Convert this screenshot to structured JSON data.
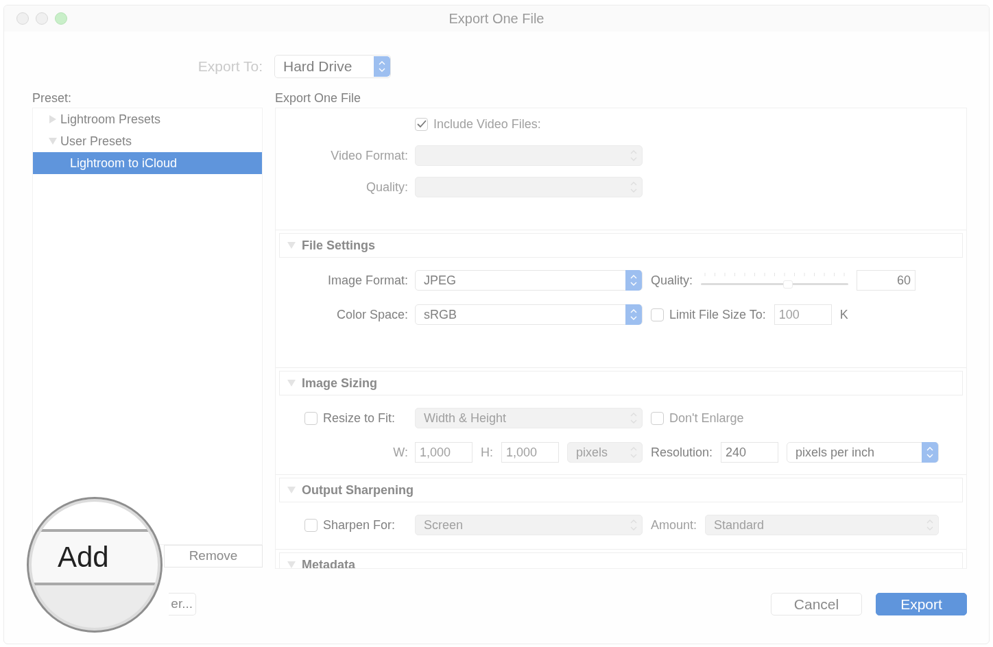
{
  "window": {
    "title": "Export One File"
  },
  "export_to": {
    "label": "Export To:",
    "value": "Hard Drive"
  },
  "preset": {
    "label": "Preset:",
    "tree": [
      {
        "label": "Lightroom Presets",
        "expanded": false,
        "selected": false
      },
      {
        "label": "User Presets",
        "expanded": true,
        "selected": false,
        "children": [
          {
            "label": "Lightroom to iCloud",
            "selected": true
          }
        ]
      }
    ],
    "remove_button": "Remove",
    "manager_button": "er..."
  },
  "magnifier": {
    "label": "Add"
  },
  "panel": {
    "title": "Export One File",
    "sections": [
      {
        "rows": [
          {
            "controls": [
              {
                "kind": "check",
                "text": "Include Video Files:",
                "checked": true,
                "disabled": true
              }
            ]
          },
          {
            "label": {
              "kind": "label",
              "text": "Video Format:",
              "disabled": true
            },
            "controls": [
              {
                "kind": "popup",
                "accent": false,
                "disabled": true
              }
            ]
          },
          {
            "label": {
              "kind": "label",
              "text": "Quality:",
              "disabled": true
            },
            "controls": [
              {
                "kind": "popup",
                "accent": false,
                "disabled": true
              }
            ]
          }
        ]
      },
      {
        "title": "File Settings",
        "expanded": true,
        "rows": [
          {
            "label": {
              "kind": "label",
              "text": "Image Format:",
              "disabled": false
            },
            "controls": [
              {
                "kind": "popup",
                "value": "JPEG",
                "accent": true,
                "disabled": false
              }
            ],
            "right": [
              {
                "kind": "label",
                "text": "Quality:",
                "disabled": false
              },
              {
                "kind": "slider",
                "level": 0.59,
                "disabled": false
              },
              {
                "kind": "number",
                "value": "60",
                "disabled": false
              }
            ]
          },
          {
            "label": {
              "kind": "label",
              "text": "Color Space:",
              "disabled": false
            },
            "controls": [
              {
                "kind": "popup",
                "value": "sRGB",
                "accent": true,
                "disabled": false
              }
            ],
            "right": [
              {
                "kind": "check",
                "text": "Limit File Size To:",
                "checked": false,
                "disabled": false
              },
              {
                "kind": "field",
                "value": "100",
                "disabled": true
              },
              {
                "kind": "unit",
                "text": "K",
                "disabled": false
              }
            ]
          }
        ]
      },
      {
        "title": "Image Sizing",
        "expanded": true,
        "rows": [
          {
            "label": {
              "kind": "check",
              "text": "Resize to Fit:",
              "checked": false,
              "disabled": false
            },
            "controls": [
              {
                "kind": "popup",
                "value": "Width & Height",
                "accent": false,
                "disabled": true
              }
            ],
            "right": [
              {
                "kind": "check",
                "text": "Don't Enlarge",
                "checked": false,
                "disabled": true
              }
            ]
          },
          {
            "label": {
              "kind": "label",
              "text": "W:",
              "disabled": true
            },
            "controls": [
              {
                "kind": "field",
                "value": "1,000",
                "disabled": true
              },
              {
                "kind": "label",
                "text": "H:",
                "disabled": true
              },
              {
                "kind": "field",
                "value": "1,000",
                "disabled": true
              },
              {
                "kind": "popup",
                "value": "pixels",
                "accent": false,
                "disabled": true
              }
            ],
            "right": [
              {
                "kind": "label",
                "text": "Resolution:",
                "disabled": false
              },
              {
                "kind": "field",
                "value": "240",
                "disabled": false
              },
              {
                "kind": "popup",
                "value": "pixels per inch",
                "accent": true,
                "disabled": false
              }
            ]
          }
        ]
      },
      {
        "title": "Output Sharpening",
        "expanded": true,
        "rows": [
          {
            "label": {
              "kind": "check",
              "text": "Sharpen For:",
              "checked": false,
              "disabled": false
            },
            "controls": [
              {
                "kind": "popup",
                "value": "Screen",
                "accent": false,
                "disabled": true
              }
            ],
            "right": [
              {
                "kind": "label",
                "text": "Amount:",
                "disabled": true
              },
              {
                "kind": "popup",
                "value": "Standard",
                "accent": false,
                "disabled": true
              }
            ]
          }
        ]
      },
      {
        "title": "Metadata",
        "expanded": true
      }
    ]
  },
  "buttons": [
    {
      "label": "Cancel",
      "default": false
    },
    {
      "label": "Export",
      "default": true
    }
  ]
}
